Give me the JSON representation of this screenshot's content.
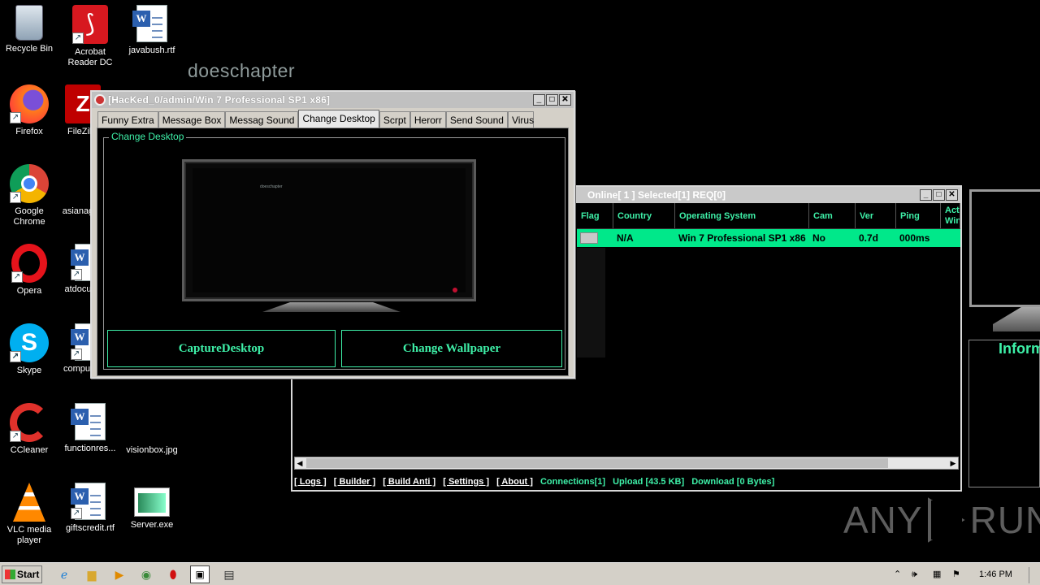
{
  "desktop": {
    "watermark_text": "doeschapter",
    "icons": [
      {
        "label": "Recycle Bin",
        "icon": "recycle-bin-icon"
      },
      {
        "label": "Acrobat Reader DC",
        "icon": "acrobat-icon"
      },
      {
        "label": "javabush.rtf",
        "icon": "word-doc-icon"
      },
      {
        "label": "Firefox",
        "icon": "firefox-icon"
      },
      {
        "label": "FileZilla",
        "icon": "filezilla-icon"
      },
      {
        "label": "Google Chrome",
        "icon": "chrome-icon"
      },
      {
        "label": "asianag",
        "icon": "file-icon"
      },
      {
        "label": "Opera",
        "icon": "opera-icon"
      },
      {
        "label": "atdocu",
        "icon": "word-doc-icon"
      },
      {
        "label": "Skype",
        "icon": "skype-icon"
      },
      {
        "label": "comput",
        "icon": "word-doc-icon"
      },
      {
        "label": "CCleaner",
        "icon": "ccleaner-icon"
      },
      {
        "label": "functionres...",
        "icon": "word-doc-icon"
      },
      {
        "label": "visionbox.jpg",
        "icon": "image-icon"
      },
      {
        "label": "VLC media player",
        "icon": "vlc-icon"
      },
      {
        "label": "giftscredit.rtf",
        "icon": "word-doc-icon"
      },
      {
        "label": "Server.exe",
        "icon": "exe-icon"
      }
    ]
  },
  "main_window": {
    "title": "Online[ 1 ]    Selected[1] REQ[0]",
    "columns": [
      "Flag",
      "Country",
      "Operating System",
      "Cam",
      "Ver",
      "Ping",
      "Acti Win"
    ],
    "rows": [
      {
        "flag": "",
        "country": "N/A",
        "os": "Win 7 Professional SP1 x86",
        "cam": "No",
        "ver": "0.7d",
        "ping": "000ms",
        "active": ""
      }
    ],
    "status_links": [
      "[ Logs ]",
      "[ Builder ]",
      "[ Build Anti ]",
      "[ Settings ]",
      "[ About ]"
    ],
    "status_values": [
      "Connections[1]",
      "Upload [43.5 KB]",
      "Download [0 Bytes]"
    ]
  },
  "dialog": {
    "title": "[HacKed_0/admin/Win 7 Professional SP1 x86]",
    "tabs": [
      "Funny Extra",
      "Message Box",
      "Messag Sound",
      "Change Desktop",
      "Scrpt",
      "Herorr",
      "Send Sound",
      "Virus"
    ],
    "active_tab": "Change Desktop",
    "group_label": "Change Desktop",
    "preview_text": "doeschapter",
    "capture_button": "CaptureDesktop",
    "wallpaper_button": "Change Wallpaper"
  },
  "right_panel": {
    "label": "Inform"
  },
  "anyrun": {
    "left": "ANY",
    "right": "RUN"
  },
  "taskbar": {
    "start_label": "Start",
    "clock": "1:46 PM",
    "pinned": [
      "ie-icon",
      "explorer-icon",
      "media-player-icon",
      "chrome-icon",
      "opera-icon",
      "rat-app-icon",
      "window-icon"
    ]
  },
  "colors": {
    "accent": "#3ef0a8",
    "row_highlight": "#00e88a"
  }
}
